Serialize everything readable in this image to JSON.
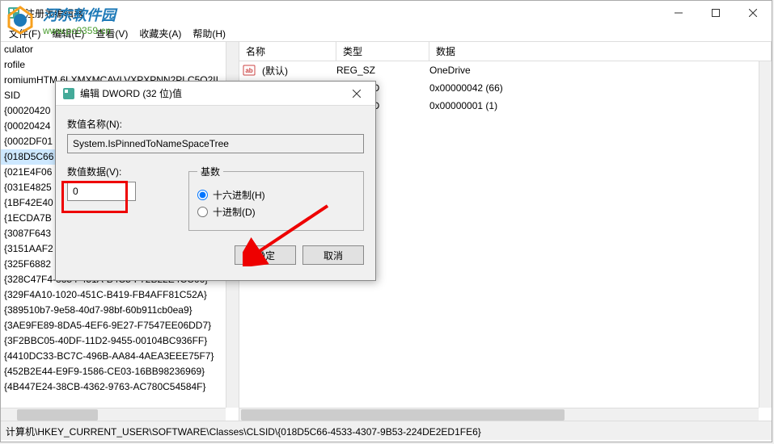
{
  "window": {
    "title": "注册表编辑器"
  },
  "menu": {
    "file": "文件(F)",
    "edit": "编辑(E)",
    "view": "查看(V)",
    "favorites": "收藏夹(A)",
    "help": "帮助(H)"
  },
  "tree": {
    "items": [
      "culator",
      "rofile",
      "romiumHTM.6LXMXMCAVLVXPXPNN2PLC5Q2II",
      "SID",
      "{00020420",
      "{00020424",
      "{0002DF01",
      "{018D5C66",
      "{021E4F06",
      "{031E4825",
      "{1BF42E40",
      "{1ECDA7B",
      "{3087F643",
      "{3151AAF2",
      "{325F6882",
      "{328C47F4-3354-451A-B4C5-F72B22E4CC66}",
      "{329F4A10-1020-451C-B419-FB4AFF81C52A}",
      "{389510b7-9e58-40d7-98bf-60b911cb0ea9}",
      "{3AE9FE89-8DA5-4EF6-9E27-F7547EE06DD7}",
      "{3F2BBC05-40DF-11D2-9455-00104BC936FF}",
      "{4410DC33-BC7C-496B-AA84-4AEA3EEE75F7}",
      "{452B2E44-E9F9-1586-CE03-16BB98236969}",
      "{4B447E24-38CB-4362-9763-AC780C54584F}"
    ],
    "selected_index": 7
  },
  "list": {
    "headers": {
      "name": "名称",
      "type": "类型",
      "data": "数据"
    },
    "rows": [
      {
        "icon": "ab",
        "name": "(默认)",
        "type": "REG_SZ",
        "data": "OneDrive"
      },
      {
        "icon": "dw",
        "name": "",
        "type": "_DWORD",
        "data": "0x00000042 (66)"
      },
      {
        "icon": "dw",
        "name": "",
        "type": "_DWORD",
        "data": "0x00000001 (1)"
      }
    ]
  },
  "statusbar": {
    "path": "计算机\\HKEY_CURRENT_USER\\SOFTWARE\\Classes\\CLSID\\{018D5C66-4533-4307-9B53-224DE2ED1FE6}"
  },
  "dialog": {
    "title": "编辑 DWORD (32 位)值",
    "name_label": "数值名称(N):",
    "name_value": "System.IsPinnedToNameSpaceTree",
    "data_label": "数值数据(V):",
    "data_value": "0",
    "base_legend": "基数",
    "radio_hex": "十六进制(H)",
    "radio_dec": "十进制(D)",
    "ok": "确定",
    "cancel": "取消"
  },
  "watermark": {
    "title": "河东软件园",
    "url": "www.pc0359.cn"
  }
}
